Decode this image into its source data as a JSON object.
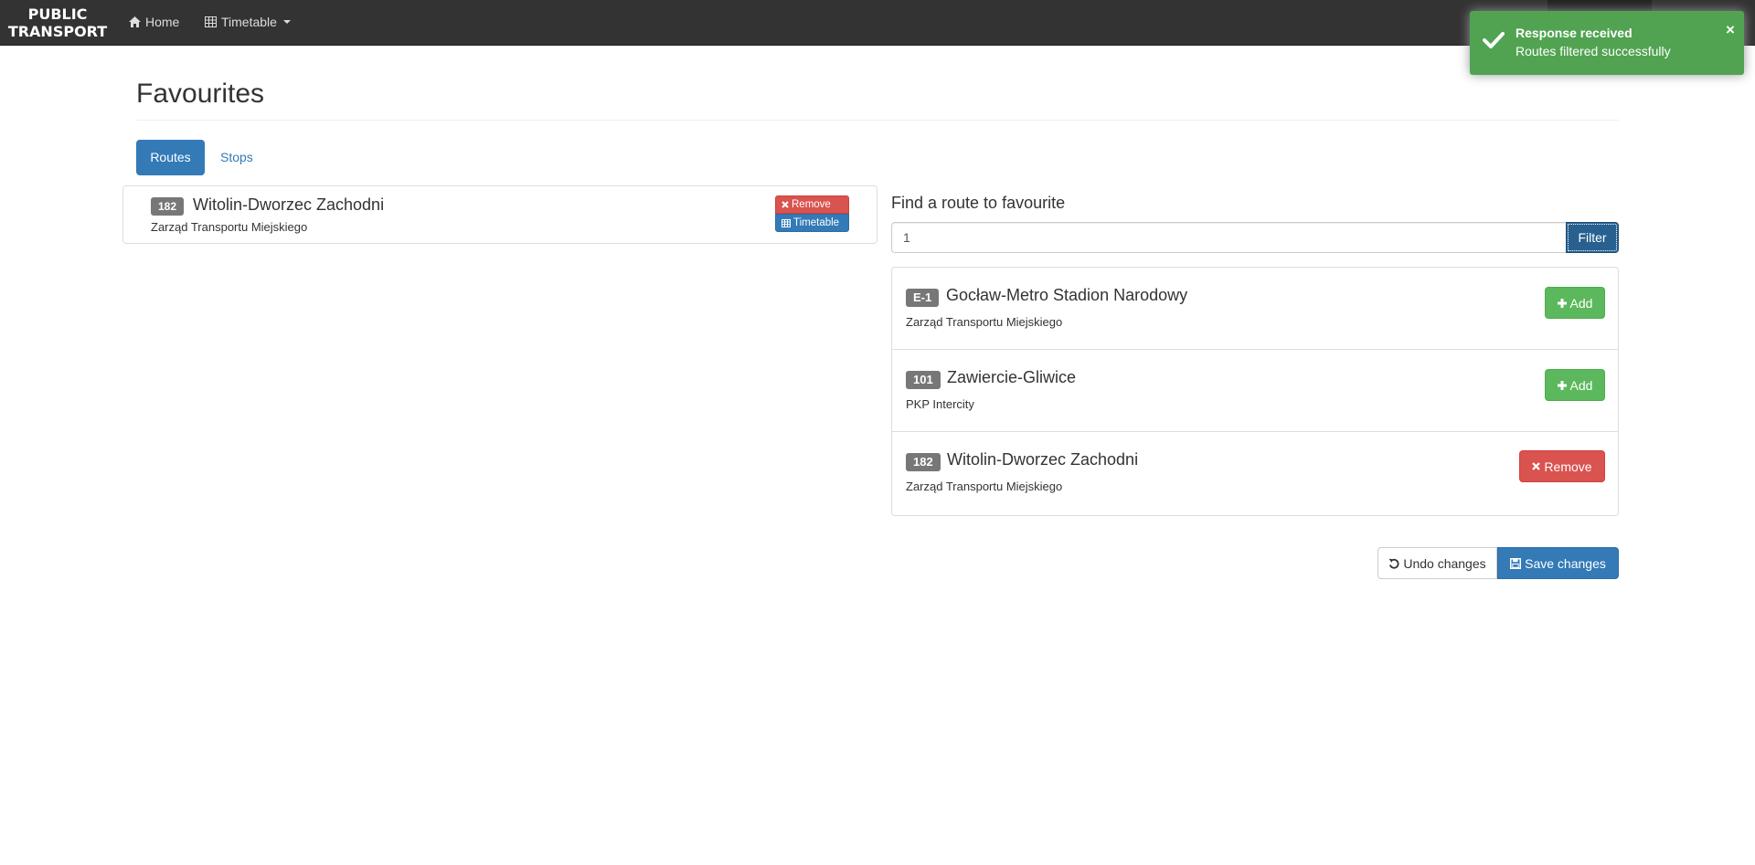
{
  "navbar": {
    "brand_line1": "PUBLIC",
    "brand_line2": "TRANSPORT",
    "home_label": "Home",
    "timetable_label": "Timetable"
  },
  "page": {
    "title": "Favourites",
    "tabs": [
      {
        "label": "Routes",
        "active": true
      },
      {
        "label": "Stops",
        "active": false
      }
    ]
  },
  "favourites": {
    "items": [
      {
        "number": "182",
        "name": "Witolin-Dworzec Zachodni",
        "operator": "Zarząd Transportu Miejskiego",
        "remove_label": "Remove",
        "timetable_label": "Timetable"
      }
    ]
  },
  "finder": {
    "title": "Find a route to favourite",
    "input_value": "1",
    "filter_label": "Filter",
    "results": [
      {
        "number": "E-1",
        "name": "Gocław-Metro Stadion Narodowy",
        "operator": "Zarząd Transportu Miejskiego",
        "action_label": "Add",
        "action": "add"
      },
      {
        "number": "101",
        "name": "Zawiercie-Gliwice",
        "operator": "PKP Intercity",
        "action_label": "Add",
        "action": "add"
      },
      {
        "number": "182",
        "name": "Witolin-Dworzec Zachodni",
        "operator": "Zarząd Transportu Miejskiego",
        "action_label": "Remove",
        "action": "remove"
      }
    ]
  },
  "actions": {
    "undo_label": "Undo changes",
    "save_label": "Save changes"
  },
  "toast": {
    "title": "Response received",
    "message": "Routes filtered successfully",
    "close_symbol": "×"
  },
  "colors": {
    "navbar": "#333333",
    "primary": "#337ab7",
    "success": "#5cb85c",
    "danger": "#d9534f",
    "toast": "#51a351",
    "badge": "#777777"
  }
}
